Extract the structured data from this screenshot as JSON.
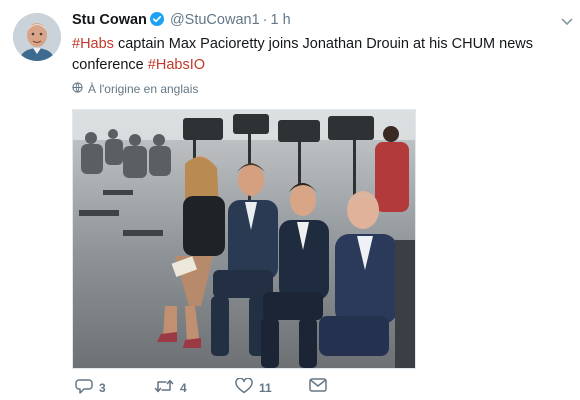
{
  "tweet": {
    "author_name": "Stu Cowan",
    "handle": "@StuCowan1",
    "separator": "·",
    "time": "1 h",
    "text": {
      "hashtag1": "#Habs",
      "part1": " captain Max Pacioretty joins Jonathan Drouin at his CHUM news conference ",
      "hashtag2": "#HabsIO"
    },
    "translate_label": "À l'origine en anglais",
    "stats": {
      "replies": "3",
      "retweets": "4",
      "likes": "11"
    }
  },
  "icons": {
    "verified": "verified-badge-icon",
    "caret": "chevron-down-icon",
    "globe": "globe-icon",
    "reply": "reply-icon",
    "retweet": "retweet-icon",
    "like": "heart-icon",
    "dm": "envelope-icon"
  },
  "colors": {
    "hashtag": "#c0392b",
    "verified": "#1da1f2",
    "muted": "#657786",
    "text": "#14171a"
  }
}
